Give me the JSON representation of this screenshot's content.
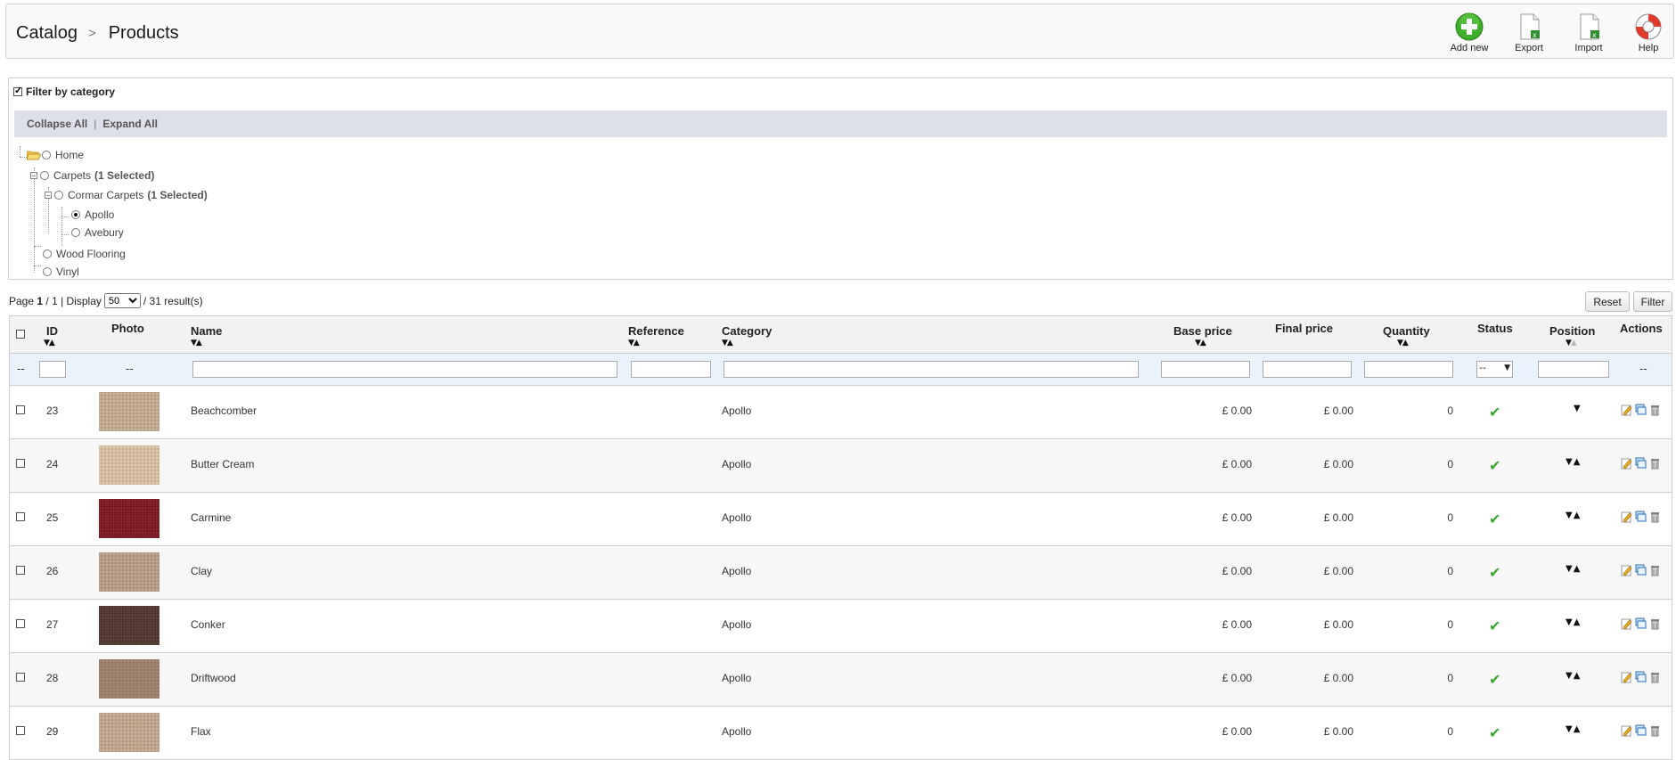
{
  "breadcrumb": {
    "root": "Catalog",
    "current": "Products"
  },
  "toolbar": {
    "add_new": "Add new",
    "export": "Export",
    "import": "Import",
    "help": "Help"
  },
  "filter_category": {
    "title": "Filter by category",
    "checked": true,
    "collapse_all": "Collapse All",
    "expand_all": "Expand All",
    "tree": {
      "home": "Home",
      "carpets": "Carpets",
      "carpets_selected": "(1 Selected)",
      "cormar": "Cormar Carpets",
      "cormar_selected": "(1 Selected)",
      "apollo": "Apollo",
      "avebury": "Avebury",
      "wood_flooring": "Wood Flooring",
      "vinyl": "Vinyl"
    }
  },
  "pager": {
    "page_label": "Page",
    "page": "1",
    "total_pages": "/ 1",
    "display_label": "| Display",
    "per_page": "50",
    "results": "/ 31 result(s)"
  },
  "buttons": {
    "reset": "Reset",
    "filter": "Filter"
  },
  "table": {
    "headers": {
      "id": "ID",
      "photo": "Photo",
      "name": "Name",
      "reference": "Reference",
      "category": "Category",
      "base_price": "Base price",
      "final_price": "Final price",
      "quantity": "Quantity",
      "status": "Status",
      "position": "Position",
      "actions": "Actions"
    },
    "filter_row": {
      "dash": "--",
      "status_select": "--"
    },
    "rows": [
      {
        "id": "23",
        "name": "Beachcomber",
        "category": "Apollo",
        "base_price": "£ 0.00",
        "final_price": "£ 0.00",
        "quantity": "0",
        "swatch": "#c4ab8d",
        "position": "down"
      },
      {
        "id": "24",
        "name": "Butter Cream",
        "category": "Apollo",
        "base_price": "£ 0.00",
        "final_price": "£ 0.00",
        "quantity": "0",
        "swatch": "#dcc0a0",
        "position": "both"
      },
      {
        "id": "25",
        "name": "Carmine",
        "category": "Apollo",
        "base_price": "£ 0.00",
        "final_price": "£ 0.00",
        "quantity": "0",
        "swatch": "#7a1018",
        "position": "both"
      },
      {
        "id": "26",
        "name": "Clay",
        "category": "Apollo",
        "base_price": "£ 0.00",
        "final_price": "£ 0.00",
        "quantity": "0",
        "swatch": "#b89c86",
        "position": "both"
      },
      {
        "id": "27",
        "name": "Conker",
        "category": "Apollo",
        "base_price": "£ 0.00",
        "final_price": "£ 0.00",
        "quantity": "0",
        "swatch": "#4a3126",
        "position": "both"
      },
      {
        "id": "28",
        "name": "Driftwood",
        "category": "Apollo",
        "base_price": "£ 0.00",
        "final_price": "£ 0.00",
        "quantity": "0",
        "swatch": "#9c7d68",
        "position": "both"
      },
      {
        "id": "29",
        "name": "Flax",
        "category": "Apollo",
        "base_price": "£ 0.00",
        "final_price": "£ 0.00",
        "quantity": "0",
        "swatch": "#c3a58a",
        "position": "both"
      }
    ]
  },
  "colors": {
    "accent_green": "#3aa632",
    "tree_bar": "#dde0e8",
    "filter_row": "#eaf3fb"
  }
}
